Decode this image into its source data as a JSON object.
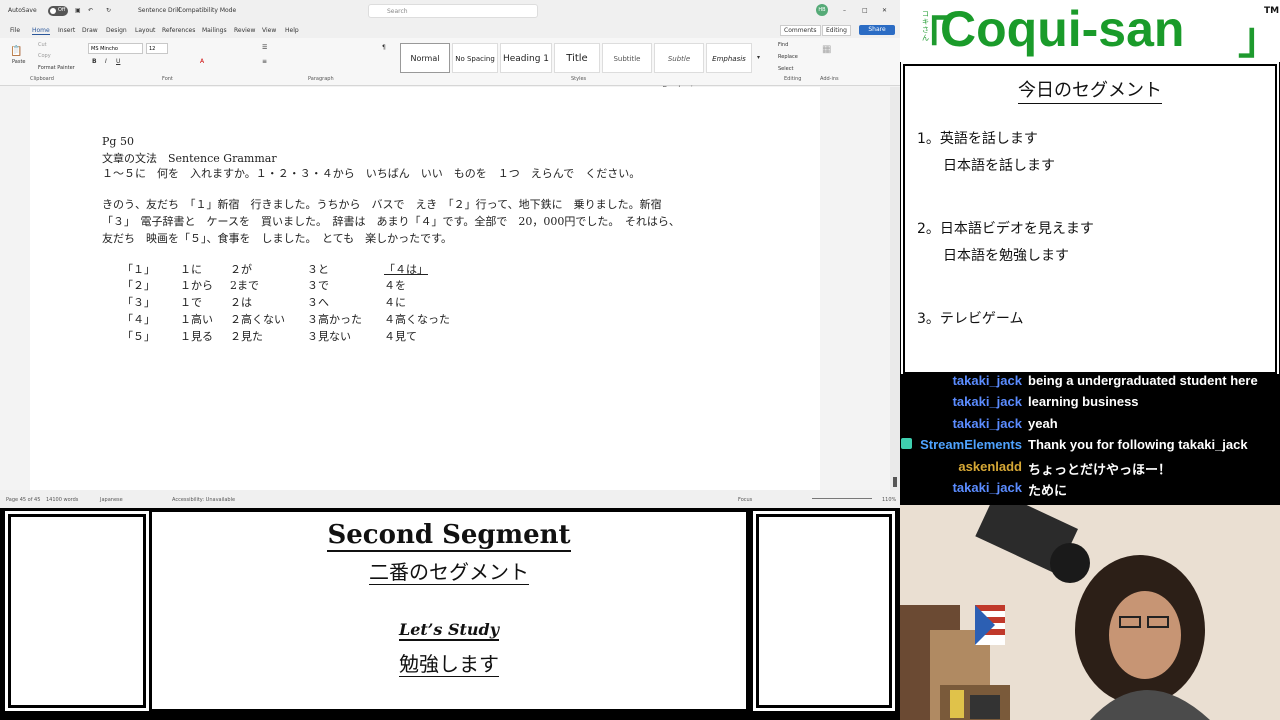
{
  "word": {
    "autosave": "AutoSave",
    "autosave_state": "Off",
    "doc_title": "Sentence Drill",
    "mode": "Compatibility Mode",
    "search_placeholder": "Search",
    "menu": [
      "File",
      "Home",
      "Insert",
      "Draw",
      "Design",
      "Layout",
      "References",
      "Mailings",
      "Review",
      "View",
      "Help"
    ],
    "comments": "Comments",
    "editing": "Editing",
    "share": "Share",
    "font_name": "MS Mincho",
    "font_size": "12",
    "styles": [
      "Normal",
      "No Spacing",
      "Heading 1",
      "Title",
      "Subtitle",
      "Subtle Emphasis",
      "Emphasis"
    ],
    "groups": [
      "Clipboard",
      "Font",
      "Paragraph",
      "Styles",
      "Editing",
      "Add-ins"
    ],
    "paste": "Paste",
    "cut": "Cut",
    "copy": "Copy",
    "format_painter": "Format Painter",
    "find": "Find",
    "replace": "Replace",
    "select": "Select",
    "doc_lines": [
      "Pg 50",
      "文章の文法　Sentence Grammar",
      "１～５に　何を　入れますか。１・２・３・４から　いちばん　いい　ものを　１つ　えらんで　ください。",
      "",
      "きのう、友だち　「１」新宿　行きました。うちから　バスで　えき　「２」行って、地下鉄に　乗りました。新宿",
      "「３」　電子辞書と　ケースを　買いました。　辞書は　あまり「４」です。全部で　20，000円でした。　それはら、",
      "友だち　映画を「５」、食事を　しました。　とても　楽しかったです。"
    ],
    "options": [
      [
        "「１」",
        "１に",
        "２が",
        "３と",
        "「４は」"
      ],
      [
        "「２」",
        "１から",
        "2まで",
        "３で",
        "４を"
      ],
      [
        "「３」",
        "１で",
        "２は",
        "３へ",
        "４に"
      ],
      [
        "「４」",
        "１高い",
        "２高くない",
        "３高かった",
        "４高くなった"
      ],
      [
        "「５」",
        "１見る",
        "２見た",
        "３見ない",
        "４見て"
      ]
    ],
    "status_page": "Page 45 of 45",
    "status_words": "14100 words",
    "status_lang": "Japanese",
    "status_access": "Accessibility: Unavailable",
    "status_focus": "Focus",
    "status_zoom": "110%"
  },
  "brand": {
    "open": "「",
    "kana": "コキさん",
    "name": "Coqui-san",
    "close": "」",
    "tm": "TM"
  },
  "segments": {
    "title": "今日のセグメント",
    "items": [
      "1。英語を話します",
      "日本語を話します",
      "2。日本語ビデオを見えます",
      "日本語を勉強します",
      "3。テレビゲーム"
    ]
  },
  "chat": [
    {
      "user": "takaki_jack",
      "text": "being a undergraduated student here",
      "color": "#5b8cff"
    },
    {
      "user": "takaki_jack",
      "text": "learning business",
      "color": "#5b8cff"
    },
    {
      "user": "takaki_jack",
      "text": "yeah",
      "color": "#5b8cff"
    },
    {
      "user": "StreamElements",
      "text": "Thank you for following takaki_jack",
      "color": "#4fa3ff"
    },
    {
      "user": "askenladd",
      "text": "ちょっとだけやっほー！",
      "color": "#d6a836"
    },
    {
      "user": "takaki_jack",
      "text": "ために",
      "color": "#5b8cff"
    }
  ],
  "center": {
    "h1": "Second Segment",
    "h2": "二番のセグメント",
    "h3": "Let’s Study",
    "h4": "勉強します"
  }
}
